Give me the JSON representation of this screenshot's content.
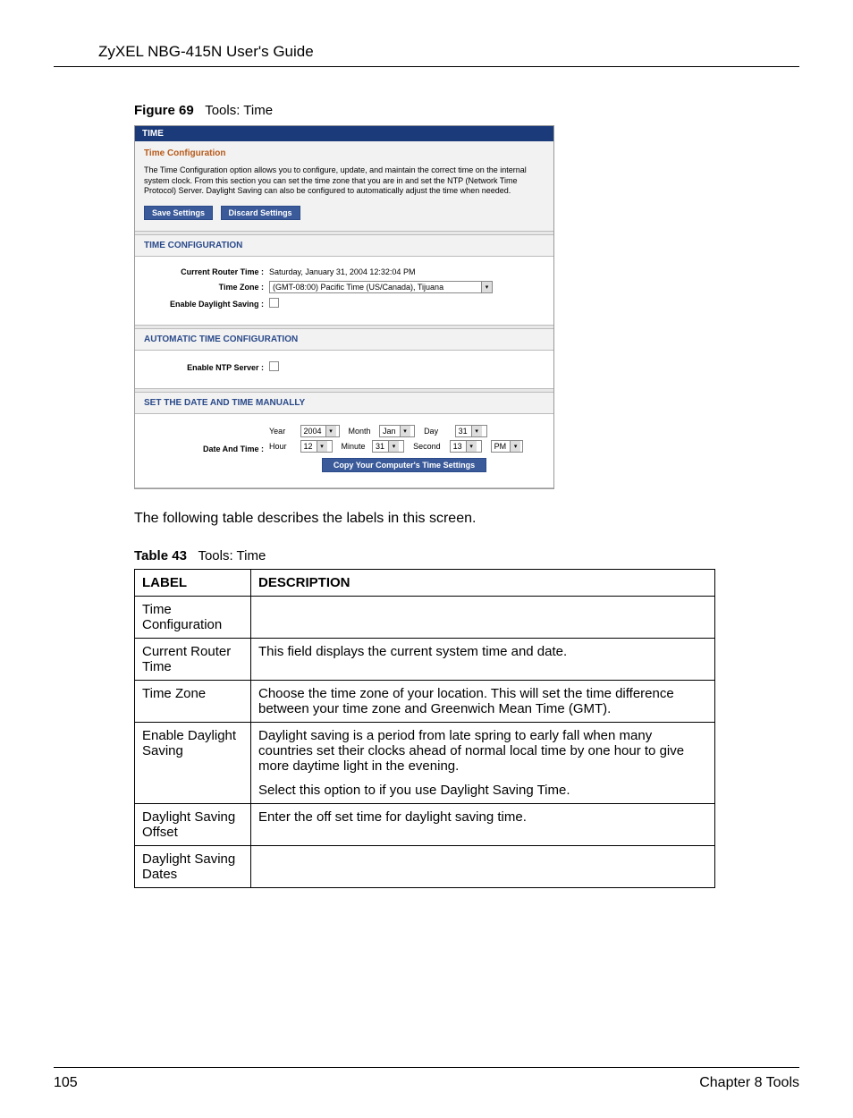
{
  "header": {
    "title": "ZyXEL NBG-415N User's Guide"
  },
  "figure": {
    "num": "Figure 69",
    "title": "Tools: Time"
  },
  "shot": {
    "titlebar": "TIME",
    "config_subhead": "Time Configuration",
    "desc": "The Time Configuration option allows you to configure, update, and maintain the correct time on the internal system clock. From this section you can set the time zone that you are in and set the NTP (Network Time Protocol) Server. Daylight Saving can also be configured to automatically adjust the time when needed.",
    "btn_save": "Save Settings",
    "btn_discard": "Discard Settings",
    "sec_timeconfig": "TIME CONFIGURATION",
    "cur_router_lbl": "Current Router Time :",
    "cur_router_val": "Saturday, January 31, 2004 12:32:04 PM",
    "tz_lbl": "Time Zone :",
    "tz_val": "(GMT-08:00) Pacific Time (US/Canada), Tijuana",
    "dst_lbl": "Enable Daylight Saving :",
    "sec_auto": "AUTOMATIC TIME CONFIGURATION",
    "ntp_lbl": "Enable NTP Server :",
    "sec_manual": "SET THE DATE AND TIME MANUALLY",
    "dt_lbl": "Date And Time :",
    "year_lbl": "Year",
    "year_val": "2004",
    "month_lbl": "Month",
    "month_val": "Jan",
    "day_lbl": "Day",
    "day_val": "31",
    "hour_lbl": "Hour",
    "hour_val": "12",
    "minute_lbl": "Minute",
    "minute_val": "31",
    "second_lbl": "Second",
    "second_val": "13",
    "ampm_val": "PM",
    "btn_copy": "Copy Your Computer's Time Settings"
  },
  "body_text": "The following table describes the labels in this screen.",
  "table_cap": {
    "num": "Table 43",
    "title": "Tools: Time"
  },
  "table": {
    "h1": "LABEL",
    "h2": "DESCRIPTION",
    "rows": [
      {
        "label": "Time Configuration",
        "desc": ""
      },
      {
        "label": "Current Router Time",
        "desc": "This field displays the current system time and date."
      },
      {
        "label": "Time Zone",
        "desc": "Choose the time zone of your location. This will set the time difference between your time zone and Greenwich Mean Time (GMT)."
      },
      {
        "label": "Enable Daylight Saving",
        "desc": "Daylight saving is a period from late spring to early fall when many countries set their clocks ahead of normal local time by one hour to give more daytime light in the evening.\nSelect this option to if you use Daylight Saving Time."
      },
      {
        "label": "Daylight Saving Offset",
        "desc": "Enter the off set time for daylight saving time."
      },
      {
        "label": "Daylight Saving Dates",
        "desc": ""
      }
    ]
  },
  "footer": {
    "page": "105",
    "chapter": "Chapter 8 Tools"
  }
}
